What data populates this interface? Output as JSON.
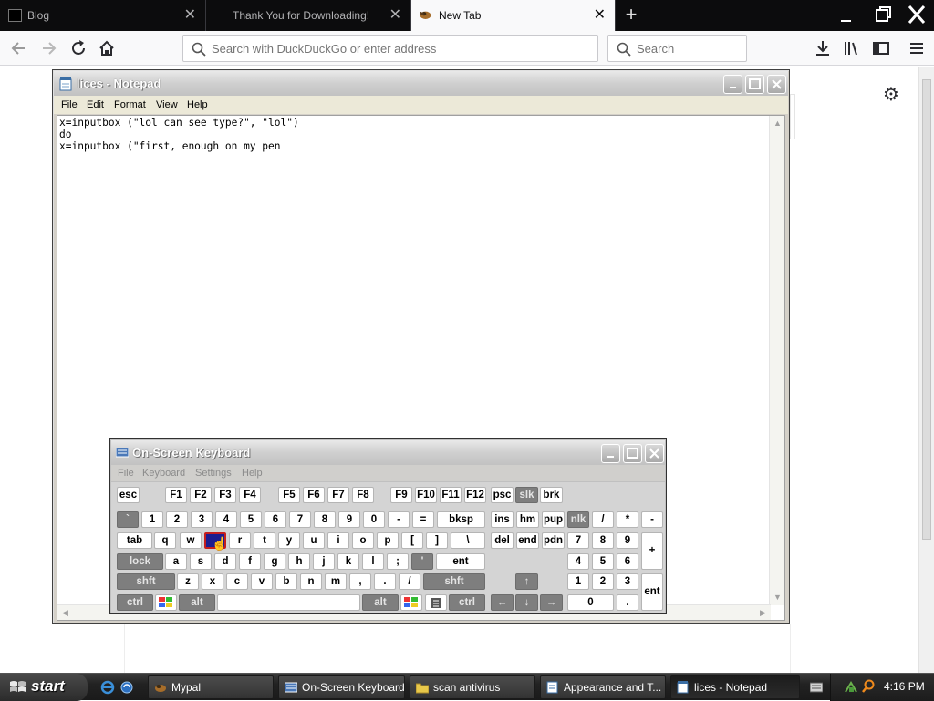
{
  "browser": {
    "tabs": [
      {
        "label": "Blog",
        "active": false
      },
      {
        "label": "Thank You for Downloading!",
        "active": false
      },
      {
        "label": "New Tab",
        "active": true
      }
    ],
    "address_placeholder": "Search with DuckDuckGo or enter address",
    "search_placeholder": "Search"
  },
  "notepad": {
    "title": "lices - Notepad",
    "menu": [
      "File",
      "Edit",
      "Format",
      "View",
      "Help"
    ],
    "content": "x=inputbox (\"lol can see type?\", \"lol\")\ndo\nx=inputbox (\"first, enough on my pen"
  },
  "osk": {
    "title": "On-Screen Keyboard",
    "menu": [
      "File",
      "Keyboard",
      "Settings",
      "Help"
    ],
    "pressed_key": "e",
    "keys": {
      "esc": "esc",
      "fkeys": [
        "F1",
        "F2",
        "F3",
        "F4",
        "F5",
        "F6",
        "F7",
        "F8",
        "F9",
        "F10",
        "F11",
        "F12"
      ],
      "psc": "psc",
      "slk": "slk",
      "brk": "brk",
      "num_row": [
        "`",
        "1",
        "2",
        "3",
        "4",
        "5",
        "6",
        "7",
        "8",
        "9",
        "0",
        "-",
        "="
      ],
      "bksp": "bksp",
      "tab": "tab",
      "q_row": [
        "q",
        "w",
        "e",
        "r",
        "t",
        "y",
        "u",
        "i",
        "o",
        "p",
        "[",
        "]",
        "\\"
      ],
      "lock": "lock",
      "a_row": [
        "a",
        "s",
        "d",
        "f",
        "g",
        "h",
        "j",
        "k",
        "l",
        ";",
        "'"
      ],
      "ent": "ent",
      "shft": "shft",
      "z_row": [
        "z",
        "x",
        "c",
        "v",
        "b",
        "n",
        "m",
        ",",
        ".",
        "/"
      ],
      "ctrl": "ctrl",
      "alt": "alt",
      "nav1": [
        "ins",
        "hm",
        "pup"
      ],
      "nav2": [
        "del",
        "end",
        "pdn"
      ],
      "num_top": [
        "nlk",
        "/",
        "*",
        "-"
      ],
      "num_r1": [
        "7",
        "8",
        "9"
      ],
      "num_r2": [
        "4",
        "5",
        "6"
      ],
      "num_r3": [
        "1",
        "2",
        "3"
      ],
      "num_zero": "0",
      "num_dot": ".",
      "num_plus": "+",
      "num_ent": "ent"
    }
  },
  "taskbar": {
    "start": "start",
    "items": [
      {
        "label": "Mypal",
        "active": false
      },
      {
        "label": "On-Screen Keyboard",
        "active": false
      },
      {
        "label": "scan antivirus",
        "active": false
      },
      {
        "label": "Appearance and T...",
        "active": false
      },
      {
        "label": "lices - Notepad",
        "active": true
      }
    ],
    "clock": "4:16 PM"
  }
}
